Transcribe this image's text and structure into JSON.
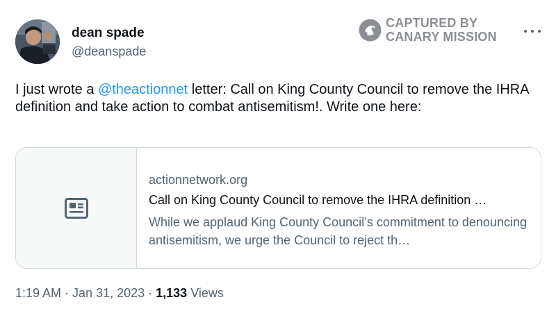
{
  "author": {
    "name": "dean spade",
    "handle": "@deanspade"
  },
  "watermark": {
    "line1": "CAPTURED BY",
    "line2": "CANARY MISSION",
    "icon": "canary-bird-icon"
  },
  "more_icon": "more-dots-icon",
  "tweet": {
    "prefix": "I just wrote a ",
    "mention": "@theactionnet",
    "suffix": " letter: Call on King County Council to remove the IHRA definition and take action to combat antisemitism!. Write one here:"
  },
  "card": {
    "icon": "article-icon",
    "domain": "actionnetwork.org",
    "title": "Call on King County Council to remove the IHRA definition …",
    "description": "While we applaud King County Council’s commitment to denouncing antisemitism, we urge the Council to reject th…"
  },
  "meta": {
    "time": "1:19 AM",
    "separator": " · ",
    "date": "Jan 31, 2023",
    "views_count": "1,133",
    "views_label": " Views"
  },
  "colors": {
    "link": "#1d9bf0",
    "secondary_text": "#536471",
    "primary_text": "#0f1419",
    "border": "#cfd9de",
    "watermark": "#8b8f94"
  }
}
